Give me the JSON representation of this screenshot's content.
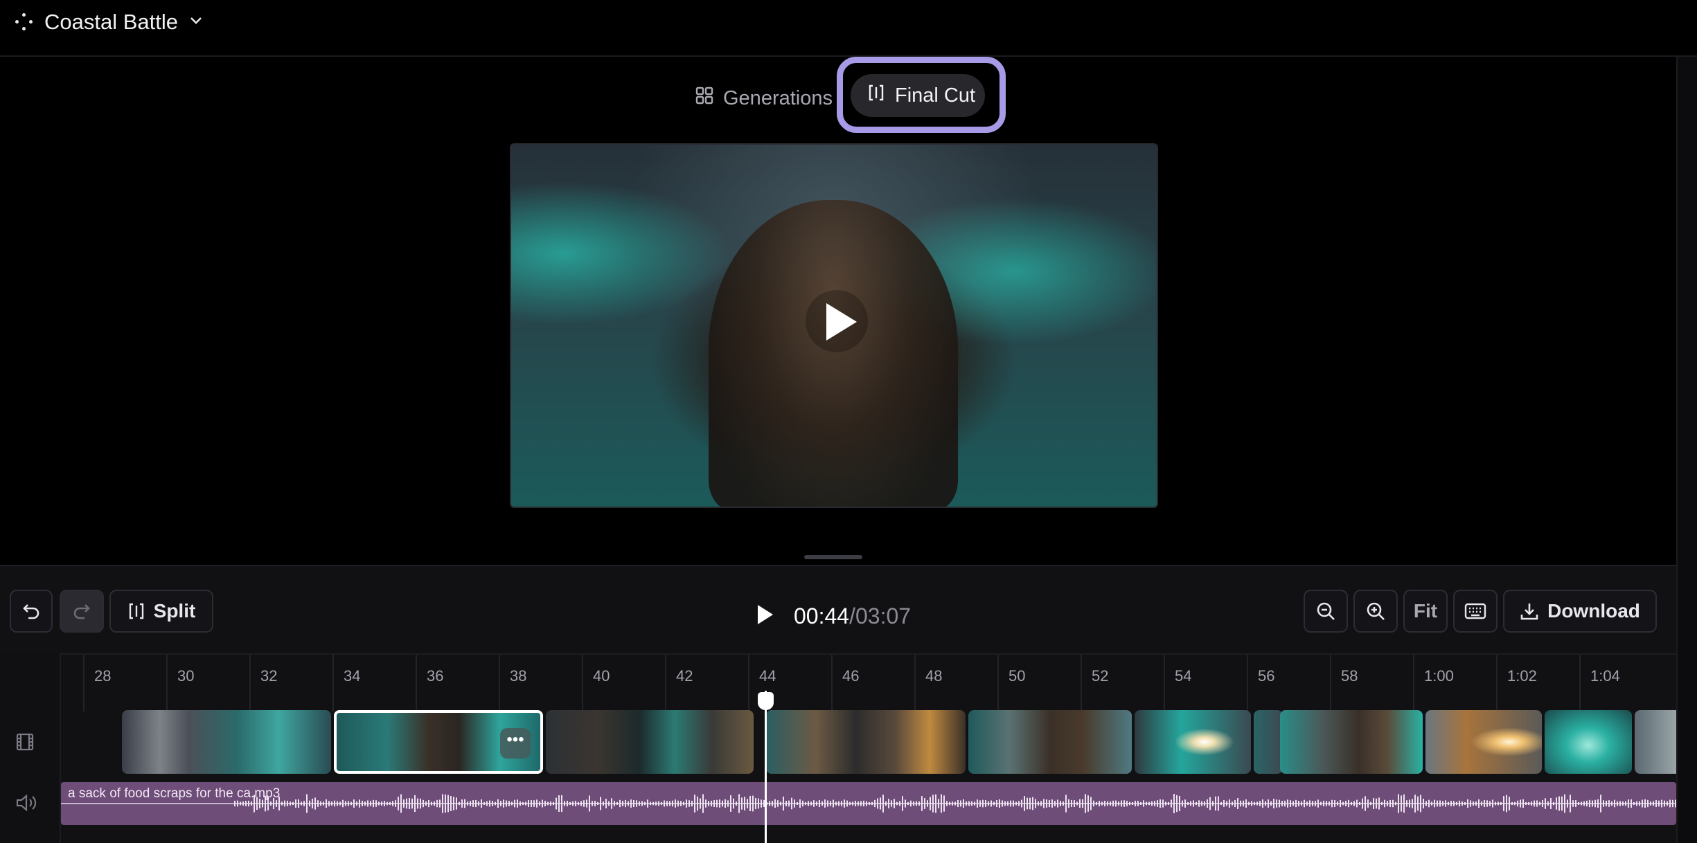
{
  "project": {
    "title": "Coastal Battle"
  },
  "view_tabs": [
    {
      "label": "Generations",
      "active": false
    },
    {
      "label": "Final Cut",
      "active": true
    }
  ],
  "toolbar": {
    "split_label": "Split",
    "fit_label": "Fit",
    "download_label": "Download",
    "current_time": "00:44",
    "total_time": "/03:07"
  },
  "ruler_labels": [
    "28",
    "30",
    "32",
    "34",
    "36",
    "38",
    "40",
    "42",
    "44",
    "46",
    "48",
    "50",
    "52",
    "54",
    "56",
    "58",
    "1:00",
    "1:02",
    "1:04"
  ],
  "audio_track": {
    "label": "a sack of food scraps for the ca.mp3",
    "color": "#6e4d78"
  },
  "colors": {
    "accent_highlight": "#a79ae6",
    "playhead": "#ffffff"
  },
  "icons": [
    "sparkle-icon",
    "chevron-down-icon",
    "grid-icon",
    "split-icon",
    "undo-icon",
    "redo-icon",
    "play-icon",
    "zoom-out-icon",
    "zoom-in-icon",
    "keyboard-icon",
    "download-icon",
    "film-icon",
    "speaker-icon",
    "more-icon"
  ]
}
